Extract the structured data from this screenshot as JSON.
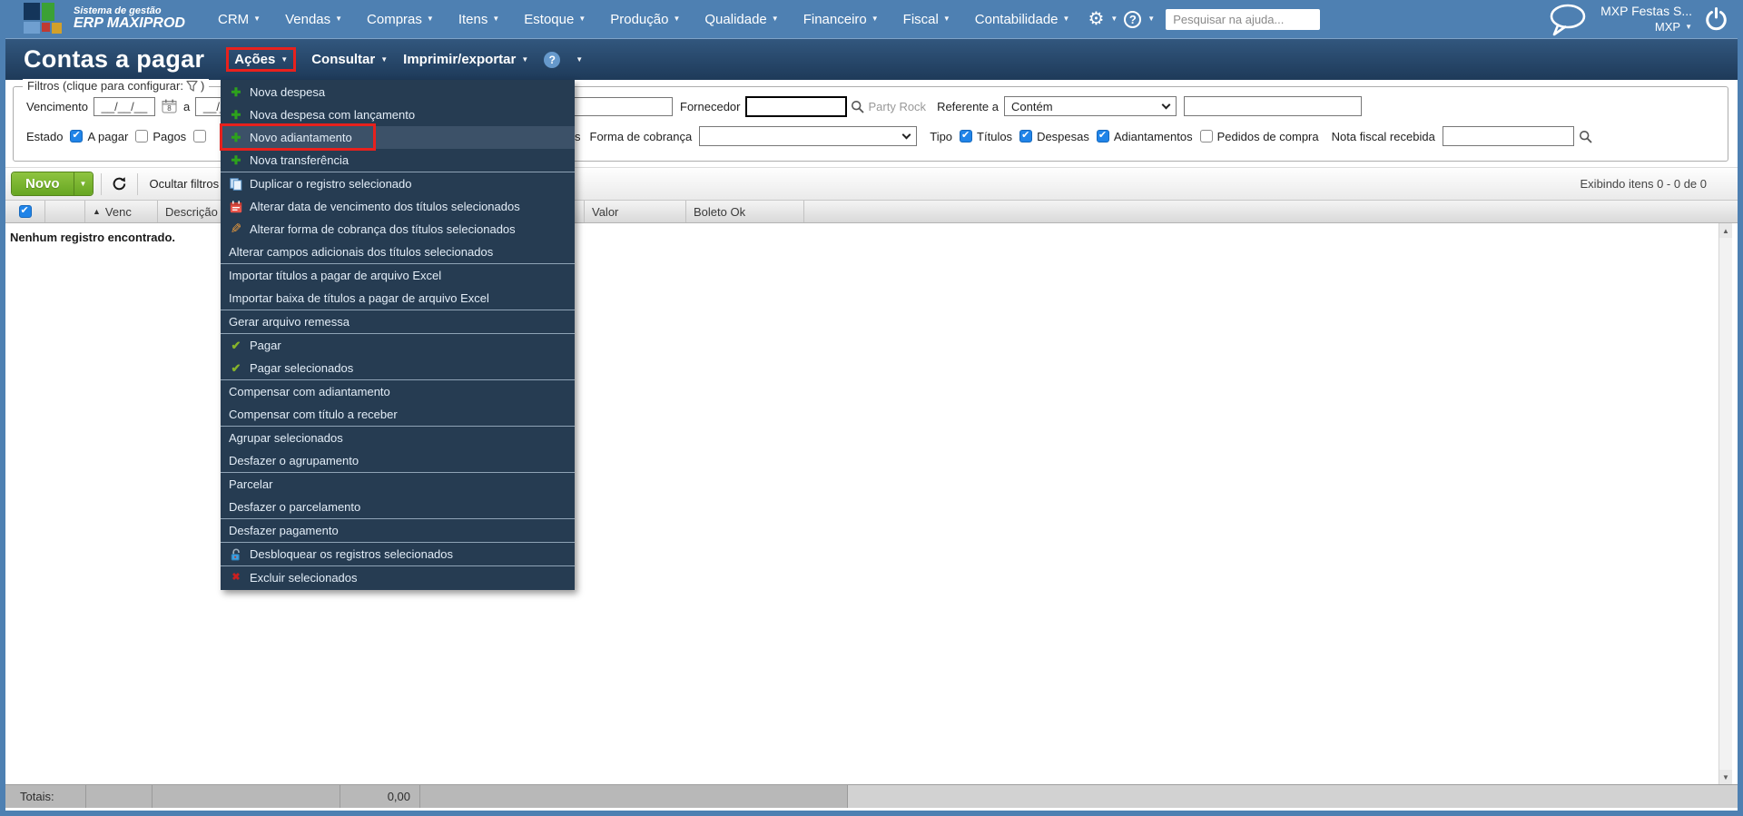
{
  "topbar": {
    "logo_line1": "Sistema de gestão",
    "logo_line2": "ERP MAXIPROD",
    "menus": [
      "CRM",
      "Vendas",
      "Compras",
      "Itens",
      "Estoque",
      "Produção",
      "Qualidade",
      "Financeiro",
      "Fiscal",
      "Contabilidade"
    ],
    "search_placeholder": "Pesquisar na ajuda...",
    "company": "MXP Festas S...",
    "user": "MXP"
  },
  "titlebar": {
    "title": "Contas a pagar",
    "menu_acoes": "Ações",
    "menu_consultar": "Consultar",
    "menu_imprimir": "Imprimir/exportar",
    "help": "?"
  },
  "actions_menu": {
    "items": [
      {
        "label": "Nova despesa",
        "icon": "plus"
      },
      {
        "label": "Nova despesa com lançamento",
        "icon": "plus"
      },
      {
        "label": "Novo adiantamento",
        "icon": "plus",
        "highlighted": true
      },
      {
        "label": "Nova transferência",
        "icon": "plus"
      },
      {
        "label": "Duplicar o registro selecionado",
        "icon": "copy"
      },
      {
        "label": "Alterar data de vencimento dos títulos selecionados",
        "icon": "calendar"
      },
      {
        "label": "Alterar forma de cobrança dos títulos selecionados",
        "icon": "pencil"
      },
      {
        "label": "Alterar campos adicionais dos títulos selecionados",
        "icon": null
      },
      {
        "label": "Importar títulos a pagar de arquivo Excel",
        "icon": null
      },
      {
        "label": "Importar baixa de títulos a pagar de arquivo Excel",
        "icon": null
      },
      {
        "label": "Gerar arquivo remessa",
        "icon": null
      },
      {
        "label": "Pagar",
        "icon": "check"
      },
      {
        "label": "Pagar selecionados",
        "icon": "check"
      },
      {
        "label": "Compensar com adiantamento",
        "icon": null
      },
      {
        "label": "Compensar com título a receber",
        "icon": null
      },
      {
        "label": "Agrupar selecionados",
        "icon": null
      },
      {
        "label": "Desfazer o agrupamento",
        "icon": null
      },
      {
        "label": "Parcelar",
        "icon": null
      },
      {
        "label": "Desfazer o parcelamento",
        "icon": null
      },
      {
        "label": "Desfazer pagamento",
        "icon": null
      },
      {
        "label": "Desbloquear os registros selecionados",
        "icon": "unlock"
      },
      {
        "label": "Excluir selecionados",
        "icon": "delete"
      }
    ]
  },
  "filters": {
    "legend": "Filtros (clique para configurar:",
    "legend_close": ")",
    "vencimento_label": "Vencimento",
    "date_mask": "__/__/__",
    "range_sep": "a",
    "fornecedor_label": "Fornecedor",
    "fornecedor_hint": "Party Rock",
    "referente_label": "Referente a",
    "referente_value": "Contém",
    "estado_label": "Estado",
    "estado_options": [
      {
        "label": "A pagar",
        "checked": true
      },
      {
        "label": "Pagos",
        "checked": false
      },
      {
        "label": "",
        "checked": false
      }
    ],
    "hidden_label_tail": "s",
    "forma_cobranca_label": "Forma de cobrança",
    "tipo_label": "Tipo",
    "tipo_options": [
      {
        "label": "Títulos",
        "checked": true
      },
      {
        "label": "Despesas",
        "checked": true
      },
      {
        "label": "Adiantamentos",
        "checked": true
      },
      {
        "label": "Pedidos de compra",
        "checked": false
      }
    ],
    "nota_fiscal_label": "Nota fiscal recebida"
  },
  "toolbar": {
    "novo_label": "Novo",
    "ocultar_label": "Ocultar filtros",
    "exibindo": "Exibindo itens 0 - 0 de 0"
  },
  "table": {
    "col_venc": "Venc",
    "col_descricao": "Descrição",
    "col_valor": "Valor",
    "col_boleto": "Boleto Ok",
    "empty_message": "Nenhum registro encontrado."
  },
  "footer": {
    "totais_label": "Totais:",
    "valor_total": "0,00"
  },
  "icons": {
    "plus": "✚",
    "check": "✔",
    "delete": "✖",
    "pencil": "✎",
    "caret": "▼",
    "sort_asc": "▲",
    "gear": "⚙",
    "scroll_up": "▲",
    "scroll_down": "▼"
  },
  "colors": {
    "topbar_blue": "#4e80b2",
    "titlebar_navy": "#24425f",
    "menu_background": "#263c52",
    "annotation_red": "#e8211d",
    "button_green": "#67a622",
    "checkbox_blue": "#2084e8"
  }
}
